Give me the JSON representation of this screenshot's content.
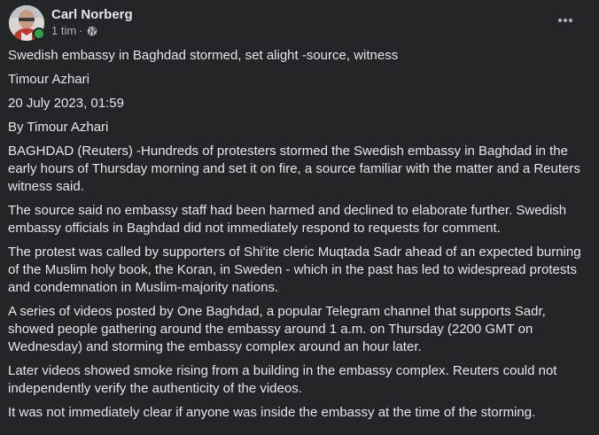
{
  "post": {
    "author": "Carl Norberg",
    "time": "1 tim",
    "separator": "·",
    "privacy_icon": "globe-icon",
    "more_icon": "more-options-icon",
    "online_status_color": "#31a24c",
    "paragraphs": [
      "Swedish embassy in Baghdad stormed, set alight -source, witness",
      "Timour Azhari",
      "20 July 2023, 01:59",
      "By Timour Azhari",
      "BAGHDAD (Reuters) -Hundreds of protesters stormed the Swedish embassy in Baghdad in the early hours of Thursday morning and set it on fire, a source familiar with the matter and a Reuters witness said.",
      "The source said no embassy staff had been harmed and declined to elaborate further. Swedish embassy officials in Baghdad did not immediately respond to requests for comment.",
      "The protest was called by supporters of Shi'ite cleric Muqtada Sadr ahead of an expected burning of the Muslim holy book, the Koran, in Sweden - which in the past has led to widespread protests and condemnation in Muslim-majority nations.",
      "A series of videos posted by One Baghdad, a popular Telegram channel that supports Sadr, showed people gathering around the embassy around 1 a.m. on Thursday (2200 GMT on Wednesday) and storming the embassy complex around an hour later.",
      "Later videos showed smoke rising from a building in the embassy complex. Reuters could not independently verify the authenticity of the videos.",
      "It was not immediately clear if anyone was inside the embassy at the time of the storming."
    ]
  }
}
